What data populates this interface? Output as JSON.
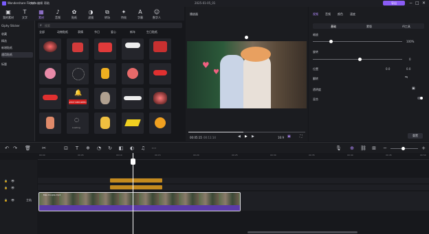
{
  "app": {
    "name": "Wondershare Filmora",
    "title": "2025-01-05_01"
  },
  "title_menu": [
    "文件",
    "编辑",
    "帮助"
  ],
  "export_label": "导出",
  "toolbar": [
    "我的素材",
    "文字",
    "素材",
    "音频",
    "贴纸",
    "滤镜",
    "转场",
    "特效",
    "字幕",
    "数字人"
  ],
  "sidebar": {
    "header": "Giphy Sticker",
    "items": [
      "收藏",
      "精选",
      "新增贴纸",
      "通用贴纸",
      "标题"
    ]
  },
  "search": {
    "placeholder": "搜索"
  },
  "filter_chips": [
    "全部",
    "动物贴纸",
    "表情",
    "节日",
    "爱心",
    "新年",
    "生日贴纸"
  ],
  "stickers": [
    "#EXT REPORTED",
    "Loading",
    "Follow"
  ],
  "preview": {
    "label": "播放器",
    "time_current": "00:05:15",
    "time_total": "00:11:14",
    "ratio": "16:9"
  },
  "right_panel": {
    "tabs": [
      "视频",
      "音频",
      "颜色",
      "速度"
    ],
    "subtabs": [
      "基础",
      "蒙版",
      "AI工具"
    ],
    "rows": [
      "缩放",
      "旋转",
      "位置",
      "翻转",
      "透明度",
      "混合",
      "阴影"
    ],
    "values": [
      "100%",
      "0",
      "0.0",
      "100%"
    ],
    "reset_label": "重置"
  },
  "timeline": {
    "ticks": [
      "00:00",
      "00:05",
      "00:10",
      "00:15",
      "00:20",
      "00:25",
      "00:30",
      "00:35",
      "00:40",
      "00:45",
      "00:50"
    ],
    "clip_label": "主轨",
    "clip_name": "Kiss Couple.mp4"
  }
}
